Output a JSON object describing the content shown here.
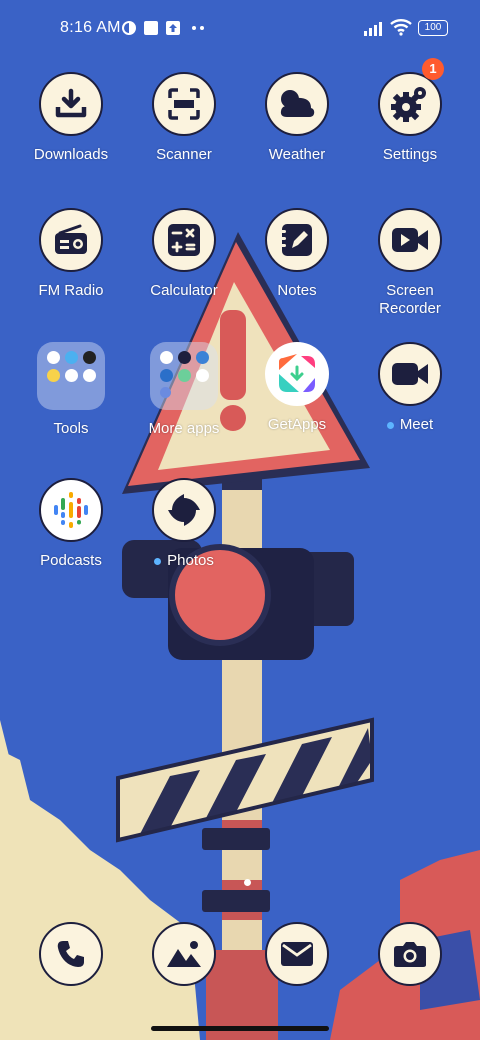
{
  "status_bar": {
    "time": "8:16 AM",
    "battery": "100"
  },
  "apps": [
    {
      "label": "Downloads",
      "icon": "download-icon"
    },
    {
      "label": "Scanner",
      "icon": "scanner-icon"
    },
    {
      "label": "Weather",
      "icon": "weather-icon"
    },
    {
      "label": "Settings",
      "icon": "gear-icon",
      "badge": "1"
    },
    {
      "label": "FM Radio",
      "icon": "radio-icon"
    },
    {
      "label": "Calculator",
      "icon": "calculator-icon"
    },
    {
      "label": "Notes",
      "icon": "notes-icon"
    },
    {
      "label": "Screen Recorder",
      "icon": "video-camera-icon"
    },
    {
      "label": "Tools",
      "icon": "folder-icon"
    },
    {
      "label": "More apps",
      "icon": "folder-icon"
    },
    {
      "label": "GetApps",
      "icon": "getapps-icon"
    },
    {
      "label": "Meet",
      "icon": "video-camera-icon"
    },
    {
      "label": "Podcasts",
      "icon": "podcasts-icon"
    },
    {
      "label": "Photos",
      "icon": "photos-icon"
    }
  ],
  "dock": [
    {
      "name": "Phone",
      "icon": "phone-icon"
    },
    {
      "name": "Gallery",
      "icon": "gallery-icon"
    },
    {
      "name": "Messages",
      "icon": "mail-icon"
    },
    {
      "name": "Camera",
      "icon": "camera-icon"
    }
  ],
  "colors": {
    "wallpaper": "#3a62c6",
    "icon_bg": "#fbf3de",
    "icon_fg": "#1d1f3e",
    "badge": "#ff5b2e",
    "new_dot": "#5db4ff"
  }
}
